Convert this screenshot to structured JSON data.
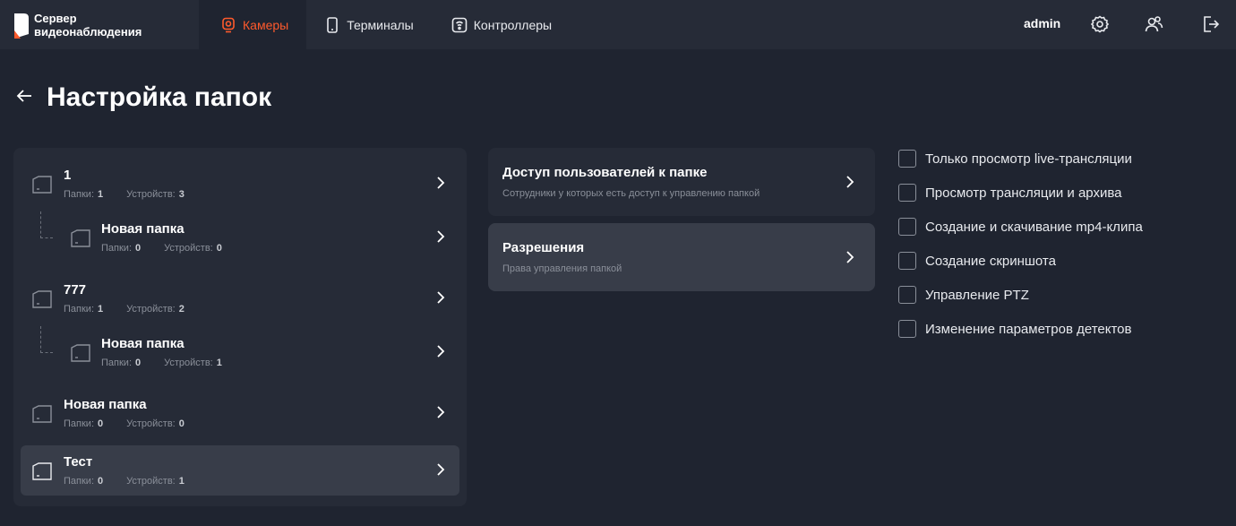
{
  "app": {
    "logo_line1": "Сервер",
    "logo_line2": "видеонаблюдения",
    "brand_color": "#ff5a2c"
  },
  "nav": {
    "cameras": "Камеры",
    "terminals": "Терминалы",
    "controllers": "Контроллеры"
  },
  "topbar": {
    "user": "admin"
  },
  "page": {
    "title": "Настройка папок"
  },
  "folders": [
    {
      "name": "1",
      "folders_label": "Папки:",
      "folders_count": "1",
      "devices_label": "Устройств:",
      "devices_count": "3"
    },
    {
      "name": "Новая папка",
      "folders_label": "Папки:",
      "folders_count": "0",
      "devices_label": "Устройств:",
      "devices_count": "0"
    },
    {
      "name": "777",
      "folders_label": "Папки:",
      "folders_count": "1",
      "devices_label": "Устройств:",
      "devices_count": "2"
    },
    {
      "name": "Новая папка",
      "folders_label": "Папки:",
      "folders_count": "0",
      "devices_label": "Устройств:",
      "devices_count": "1"
    },
    {
      "name": "Новая папка",
      "folders_label": "Папки:",
      "folders_count": "0",
      "devices_label": "Устройств:",
      "devices_count": "0"
    },
    {
      "name": "Тест",
      "folders_label": "Папки:",
      "folders_count": "0",
      "devices_label": "Устройств:",
      "devices_count": "1"
    }
  ],
  "cards": [
    {
      "title": "Доступ пользователей к папке",
      "subtitle": "Сотрудники у которых есть доступ к управлению папкой"
    },
    {
      "title": "Разрешения",
      "subtitle": "Права управления папкой"
    }
  ],
  "permissions": [
    "Только просмотр live-трансляции",
    "Просмотр трансляции и архива",
    "Создание и скачивание mp4-клипа",
    "Создание скриншота",
    "Управление PTZ",
    "Изменение параметров детектов"
  ]
}
